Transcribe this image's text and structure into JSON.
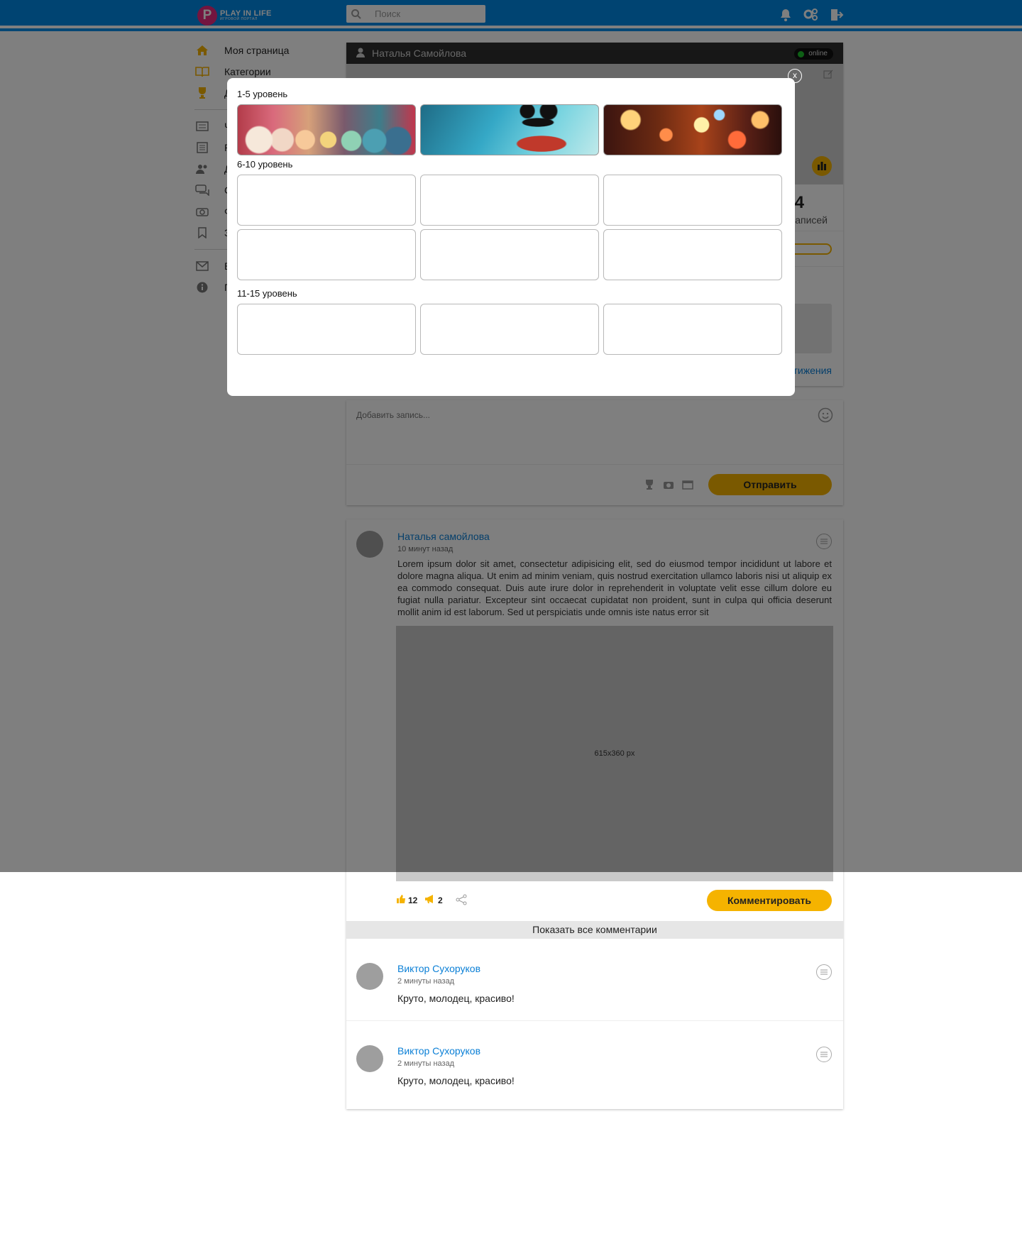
{
  "header": {
    "logo_title": "PLAY IN LIFE",
    "logo_subtitle": "ИГРОВОЙ ПОРТАЛ",
    "logo_letter": "P",
    "search_placeholder": "Поиск"
  },
  "sidebar": {
    "items": [
      {
        "label": "Моя страница",
        "icon": "home-icon"
      },
      {
        "label": "Категории",
        "icon": "book-icon"
      },
      {
        "label": "Д",
        "icon": "trophy-icon"
      },
      {
        "label": "Ч",
        "icon": "news-icon"
      },
      {
        "label": "Р",
        "icon": "list-icon"
      },
      {
        "label": "Д",
        "icon": "friends-icon"
      },
      {
        "label": "С",
        "icon": "chat-icon"
      },
      {
        "label": "Ф",
        "icon": "camera-icon"
      },
      {
        "label": "З",
        "icon": "bookmark-icon"
      },
      {
        "label": "В",
        "icon": "mail-icon"
      },
      {
        "label": "П",
        "icon": "info-icon"
      }
    ]
  },
  "profile": {
    "name": "Наталья Самойлова",
    "status": "online",
    "stat_number": "4",
    "stat_label": "записей",
    "achievements_link": "тижения"
  },
  "post_form": {
    "placeholder": "Добавить запись...",
    "send_label": "Отправить"
  },
  "post": {
    "author": "Наталья самойлова",
    "time": "10 минут назад",
    "text": "Lorem ipsum dolor sit amet, consectetur adipisicing elit, sed do eiusmod tempor incididunt ut labore et dolore magna aliqua. Ut enim ad minim veniam, quis nostrud exercitation ullamco laboris nisi ut aliquip ex ea commodo consequat. Duis aute irure dolor in reprehenderit in voluptate velit esse cillum dolore eu fugiat nulla pariatur. Excepteur sint occaecat cupidatat non proident, sunt in culpa qui officia deserunt mollit anim id est laborum. Sed ut perspiciatis unde omnis iste natus error sit",
    "image_label": "615x360 px",
    "likes": "12",
    "reposts": "2",
    "comment_label": "Комментировать",
    "show_all_label": "Показать все комментарии"
  },
  "comments": [
    {
      "author": "Виктор Сухоруков",
      "time": "2 минуты назад",
      "text": "Круто, молодец, красиво!"
    },
    {
      "author": "Виктор Сухоруков",
      "time": "2 минуты назад",
      "text": "Круто, молодец, красиво!"
    }
  ],
  "modal": {
    "close_label": "x",
    "levels": [
      {
        "title": "1-5 уровень"
      },
      {
        "title": "6-10 уровень"
      },
      {
        "title": "11-15 уровень"
      }
    ]
  },
  "colors": {
    "header_blue": "#0188e4",
    "accent_yellow": "#f5b300",
    "link_blue": "#0a7fd6",
    "logo_pink": "#e72b7f",
    "online_green": "#1dbf2b"
  }
}
